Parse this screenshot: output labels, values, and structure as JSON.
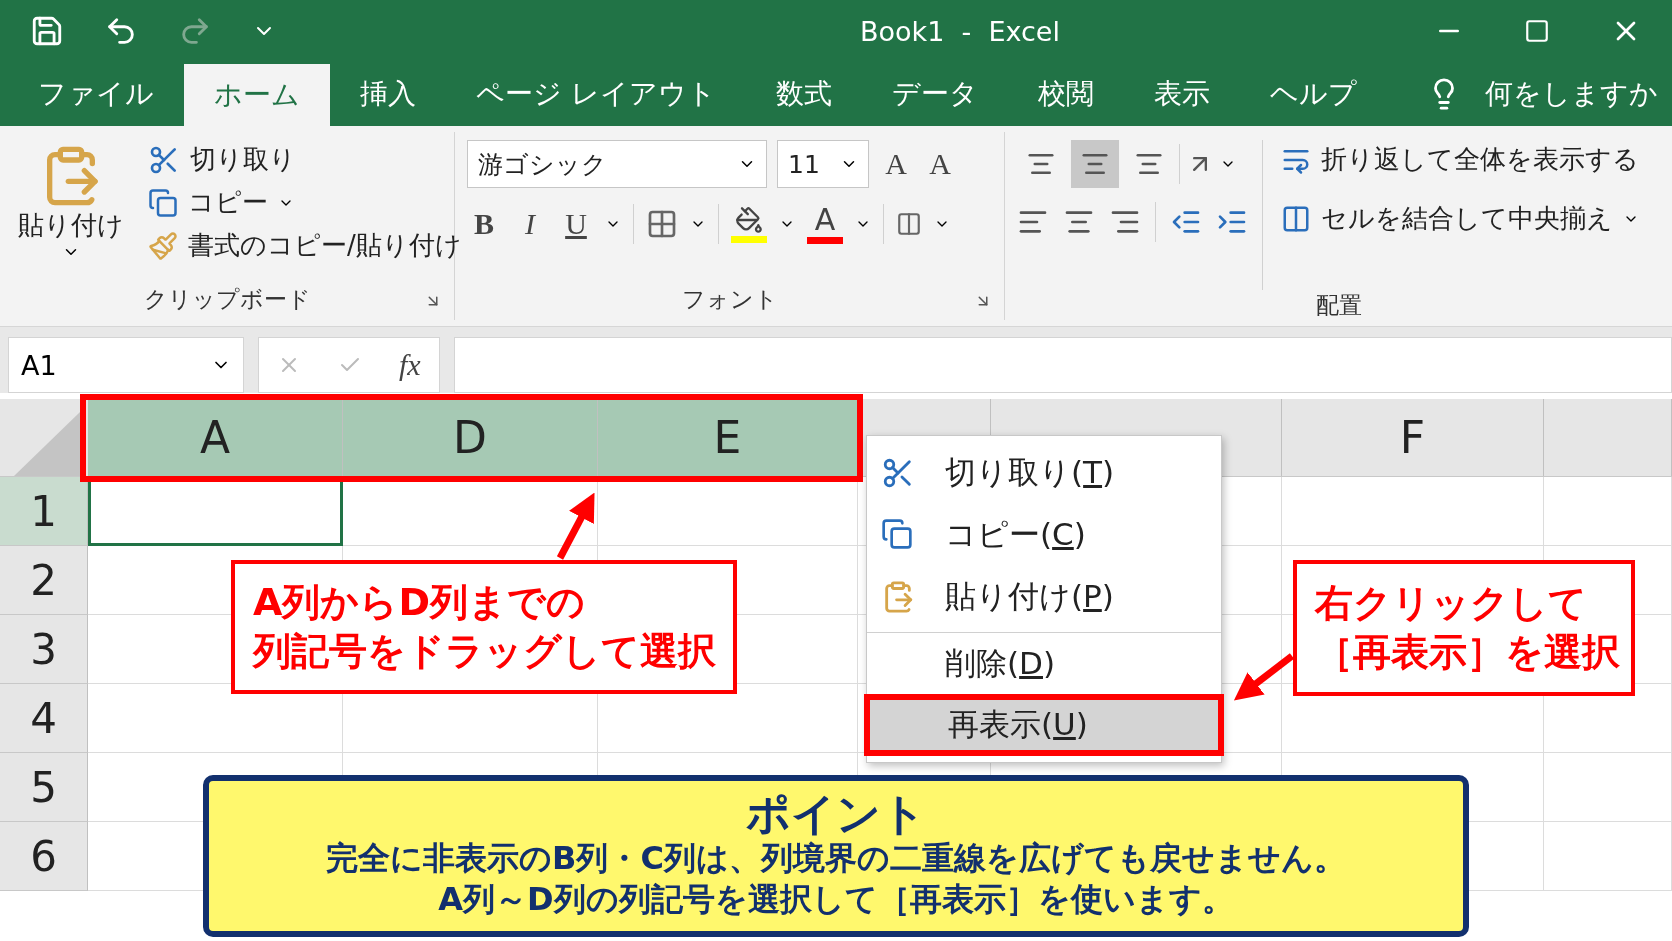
{
  "window": {
    "title": "Book1  -  Excel"
  },
  "tabs": [
    {
      "label": "ファイル",
      "selected": false
    },
    {
      "label": "ホーム",
      "selected": true
    },
    {
      "label": "挿入",
      "selected": false
    },
    {
      "label": "ページ レイアウト",
      "selected": false
    },
    {
      "label": "数式",
      "selected": false
    },
    {
      "label": "データ",
      "selected": false
    },
    {
      "label": "校閲",
      "selected": false
    },
    {
      "label": "表示",
      "selected": false
    },
    {
      "label": "ヘルプ",
      "selected": false
    }
  ],
  "tell_me": {
    "placeholder": "何をしますか"
  },
  "ribbon": {
    "clipboard": {
      "paste": "貼り付け",
      "cut": "切り取り",
      "copy": "コピー",
      "format_painter": "書式のコピー/貼り付け",
      "group": "クリップボード"
    },
    "font": {
      "name": "游ゴシック",
      "size": "11",
      "grow": "A",
      "shrink": "A",
      "bold": "B",
      "italic": "I",
      "underline": "U",
      "font_color": "A",
      "group": "フォント"
    },
    "alignment": {
      "vertical": [
        {
          "selected": false
        },
        {
          "selected": true
        },
        {
          "selected": false
        }
      ],
      "wrap": "折り返して全体を表示する",
      "merge": "セルを結合して中央揃え",
      "group": "配置"
    }
  },
  "formula_bar": {
    "name_box": "A1",
    "fx": "fx"
  },
  "columns": [
    {
      "label": "A",
      "selected": true
    },
    {
      "label": "D",
      "selected": true
    },
    {
      "label": "E",
      "selected": true
    },
    {
      "selected": false
    },
    {
      "selected": false
    },
    {
      "label": "F",
      "selected": false
    },
    {
      "selected": false
    }
  ],
  "rows": [
    {
      "label": "1",
      "selected": true
    },
    {
      "label": "2",
      "selected": false
    },
    {
      "label": "3",
      "selected": false
    },
    {
      "label": "4",
      "selected": false
    },
    {
      "label": "5",
      "selected": false
    },
    {
      "label": "6",
      "selected": false
    }
  ],
  "context_menu": [
    {
      "kind": "cut",
      "before": "切り取り(",
      "key": "T",
      "after": ")",
      "selected": false,
      "separator_before": false
    },
    {
      "kind": "copy",
      "before": "コピー(",
      "key": "C",
      "after": ")",
      "selected": false,
      "separator_before": false
    },
    {
      "kind": "paste",
      "before": "貼り付け(",
      "key": "P",
      "after": ")",
      "selected": false,
      "separator_before": false
    },
    {
      "kind": "plain",
      "before": "削除(",
      "key": "D",
      "after": ")",
      "selected": false,
      "separator_before": true
    },
    {
      "kind": "plain",
      "before": "再表示(",
      "key": "U",
      "after": ")",
      "selected": true,
      "separator_before": false
    }
  ],
  "callouts": [
    {
      "lines": [
        "A列からD列までの",
        "列記号をドラッグして選択"
      ]
    },
    {
      "lines": [
        "右クリックして",
        "［再表示］を選択"
      ]
    }
  ],
  "point": {
    "title": "ポイント",
    "lines": [
      "完全に非表示のB列・C列は、列境界の二重線を広げても戻せません。",
      "A列～D列の列記号を選択して［再表示］を使います。"
    ]
  }
}
